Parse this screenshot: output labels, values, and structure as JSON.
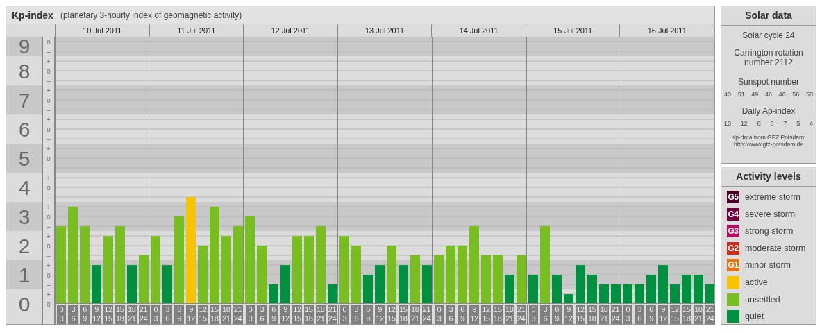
{
  "kp_panel": {
    "title": "Kp-index",
    "subtitle": "(planetary 3-hourly index of geomagnetic activity)",
    "date_labels": [
      "10 Jul 2011",
      "11 Jul 2011",
      "12 Jul 2011",
      "13 Jul 2011",
      "14 Jul 2011",
      "15 Jul 2011",
      "16 Jul 2011"
    ],
    "minor_tick_labels": [
      "o",
      "–",
      "+",
      "o",
      "–",
      "+",
      "o",
      "–",
      "+",
      "o",
      "–",
      "+",
      "o",
      "–",
      "+",
      "o",
      "–",
      "+",
      "o",
      "–",
      "+",
      "o",
      "–",
      "+",
      "o",
      "–",
      "+",
      "o"
    ],
    "chart_data": {
      "type": "bar",
      "ylim": [
        0,
        9.17
      ],
      "grid": true,
      "yticks": [
        {
          "value": 9,
          "label": "9"
        },
        {
          "value": 8,
          "label": "8"
        },
        {
          "value": 7,
          "label": "7"
        },
        {
          "value": 6,
          "label": "6"
        },
        {
          "value": 5,
          "label": "5"
        },
        {
          "value": 4,
          "label": "4"
        },
        {
          "value": 3,
          "label": "3"
        },
        {
          "value": 2,
          "label": "2"
        },
        {
          "value": 1,
          "label": "1"
        },
        {
          "value": 0,
          "label": "0"
        }
      ],
      "categories": [
        "0 3",
        "3 6",
        "6 9",
        "9 12",
        "12 15",
        "15 18",
        "18 21",
        "21 24",
        "0 3",
        "3 6",
        "6 9",
        "9 12",
        "12 15",
        "15 18",
        "18 21",
        "21 24",
        "0 3",
        "3 6",
        "6 9",
        "9 12",
        "12 15",
        "15 18",
        "18 21",
        "21 24",
        "0 3",
        "3 6",
        "6 9",
        "9 12",
        "12 15",
        "15 18",
        "18 21",
        "21 24",
        "0 3",
        "3 6",
        "6 9",
        "9 12",
        "12 15",
        "15 18",
        "18 21",
        "21 24",
        "0 3",
        "3 6",
        "6 9",
        "9 12",
        "12 15",
        "15 18",
        "18 21",
        "21 24",
        "0 3",
        "3 6",
        "6 9",
        "9 12",
        "12 15",
        "15 18",
        "18 21",
        "21 24"
      ],
      "series": [
        {
          "color": "#009040",
          "values": [
            null,
            null,
            null,
            1.33,
            null,
            null,
            1.33,
            null,
            null,
            1.33,
            null,
            null,
            null,
            null,
            null,
            null,
            null,
            null,
            0.67,
            1.33,
            null,
            null,
            null,
            0.67,
            null,
            null,
            1,
            1.33,
            null,
            1.33,
            null,
            1.33,
            null,
            null,
            null,
            null,
            null,
            null,
            1,
            null,
            1,
            null,
            1,
            0.33,
            1.33,
            1,
            0.67,
            0.67,
            0.67,
            0.67,
            1,
            1.33,
            0.67,
            1,
            1,
            0.67
          ]
        },
        {
          "color": "#78be20",
          "values": [
            2.67,
            3.33,
            2.67,
            null,
            2.33,
            2.67,
            null,
            1.67,
            2.33,
            null,
            3,
            null,
            2,
            3.33,
            2.33,
            2.67,
            3,
            2,
            null,
            null,
            2.33,
            2.33,
            2.67,
            null,
            2.33,
            2,
            null,
            null,
            2,
            null,
            1.67,
            null,
            1.67,
            2,
            2,
            2.67,
            1.67,
            1.67,
            null,
            1.67,
            null,
            2.67,
            null,
            null,
            null,
            null,
            null,
            null,
            null,
            null,
            null,
            null,
            null,
            null,
            null,
            null
          ]
        },
        {
          "color": "#f8c400",
          "values": [
            null,
            null,
            null,
            null,
            null,
            null,
            null,
            null,
            null,
            null,
            null,
            3.67,
            null,
            null,
            null,
            null,
            null,
            null,
            null,
            null,
            null,
            null,
            null,
            null,
            null,
            null,
            null,
            null,
            null,
            null,
            null,
            null,
            null,
            null,
            null,
            null,
            null,
            null,
            null,
            null,
            null,
            null,
            null,
            null,
            null,
            null,
            null,
            null,
            null,
            null,
            null,
            null,
            null,
            null,
            null,
            null
          ]
        }
      ]
    }
  },
  "solar_data": {
    "title": "Solar data",
    "solar_cycle": "Solar cycle 24",
    "carrington": "Carrington rotation number 2112",
    "sunspot_label": "Sunspot number",
    "sunspot_numbers": [
      "40",
      "51",
      "49",
      "46",
      "46",
      "56",
      "50"
    ],
    "ap_label": "Daily Ap-index",
    "ap_values": [
      "10",
      "12",
      "8",
      "6",
      "7",
      "5",
      "4"
    ],
    "source_lines": [
      "Kp-data from GFZ Potsdam:",
      "http://www.gfz-potsdam.de"
    ]
  },
  "activity_levels": {
    "title": "Activity levels",
    "items": [
      {
        "badge": "G5",
        "label": "extreme storm",
        "color": "#4a0024"
      },
      {
        "badge": "G4",
        "label": "severe storm",
        "color": "#720040"
      },
      {
        "badge": "G3",
        "label": "strong storm",
        "color": "#b0105c"
      },
      {
        "badge": "G2",
        "label": "moderate storm",
        "color": "#d42a18"
      },
      {
        "badge": "G1",
        "label": "minor storm",
        "color": "#e2761a"
      },
      {
        "label": "active",
        "color": "#f8c400"
      },
      {
        "label": "unsettled",
        "color": "#78be20"
      },
      {
        "label": "quiet",
        "color": "#009040"
      }
    ]
  }
}
